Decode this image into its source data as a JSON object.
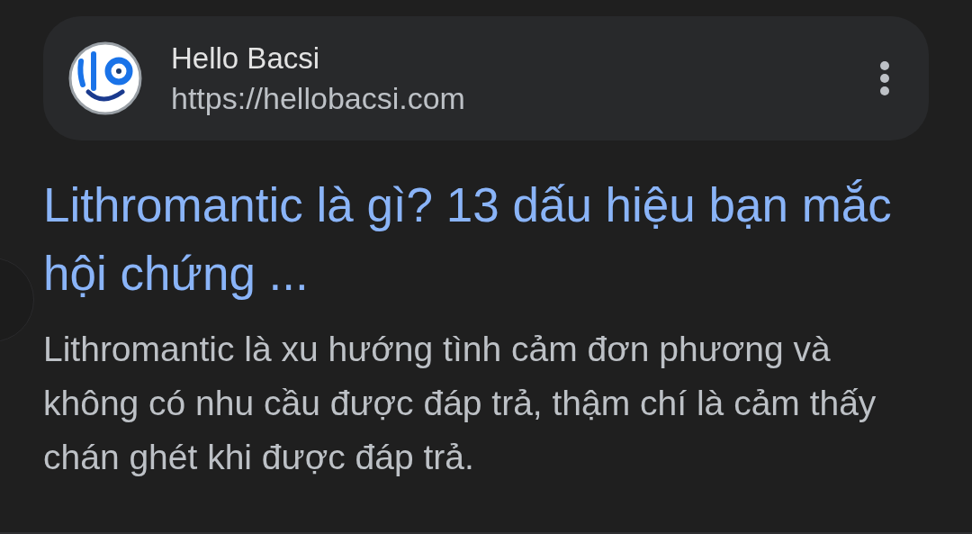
{
  "site": {
    "name": "Hello Bacsi",
    "url": "https://hellobacsi.com"
  },
  "result": {
    "title": "Lithromantic là gì? 13 dấu hiệu bạn mắc hội chứng ...",
    "snippet": "Lithromantic là xu hướng tình cảm đơn phương và không có nhu cầu được đáp trả, thậm chí là cảm thấy chán ghét khi được đáp trả."
  }
}
